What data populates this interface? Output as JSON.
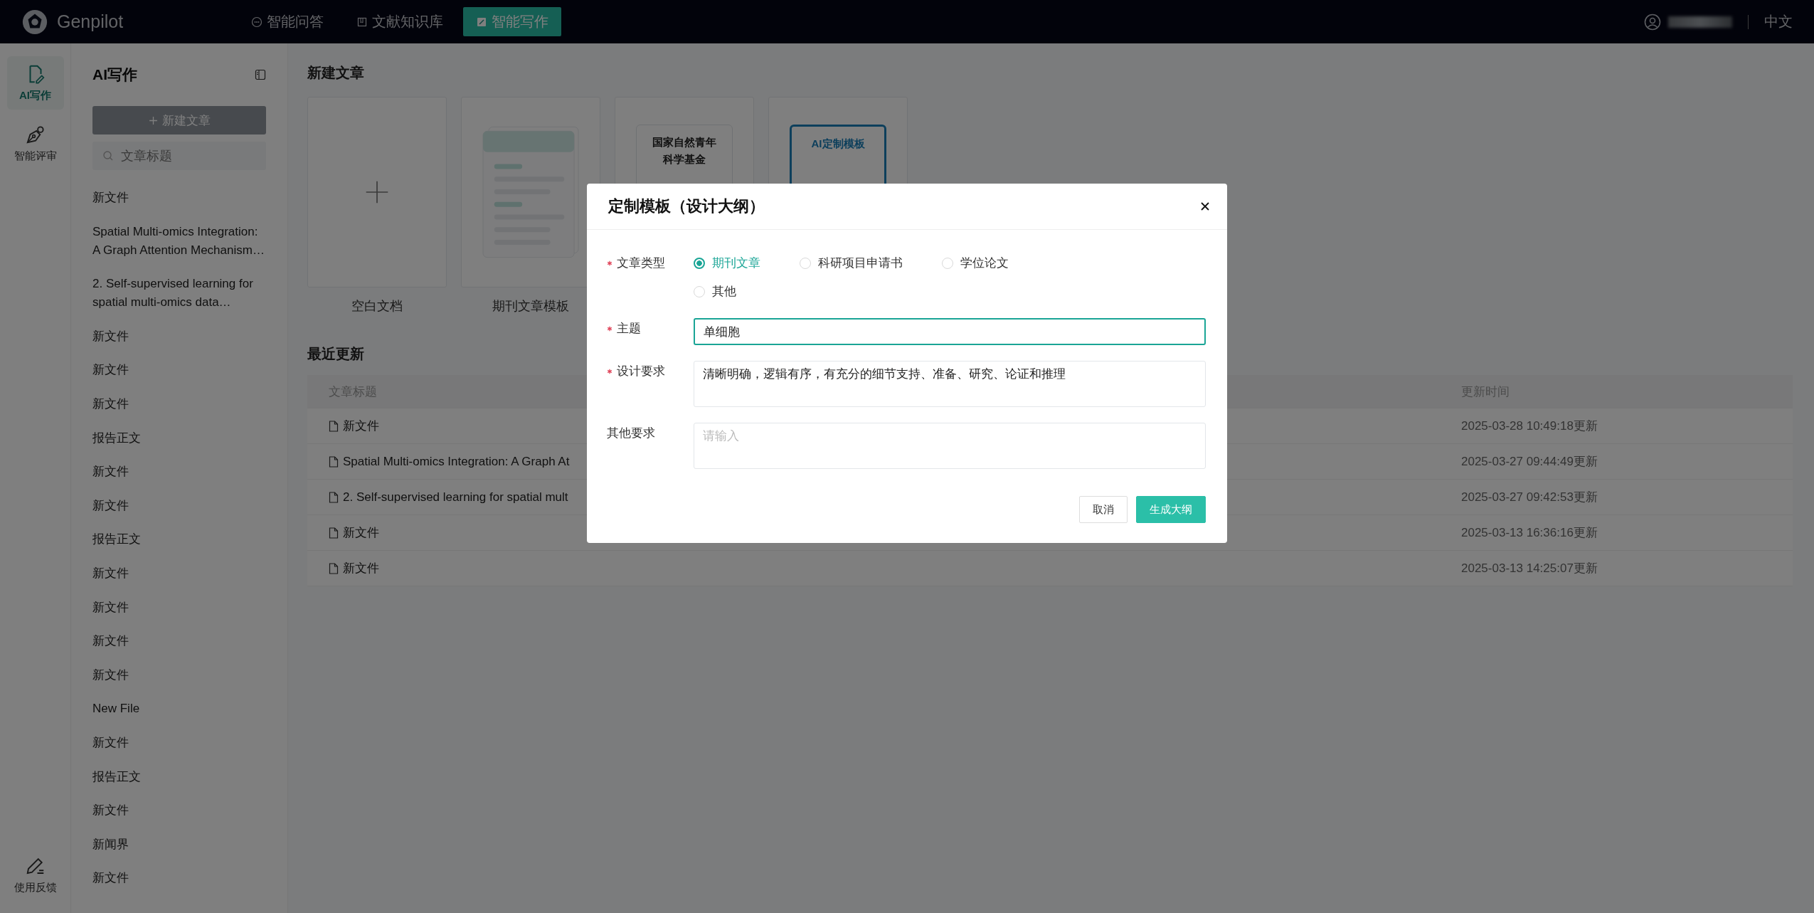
{
  "topbar": {
    "brand": "Genpilot",
    "nav": [
      {
        "label": "智能问答",
        "kind": "chat",
        "selected": false
      },
      {
        "label": "文献知识库",
        "kind": "book",
        "selected": false
      },
      {
        "label": "智能写作",
        "kind": "write",
        "selected": true
      }
    ],
    "language": "中文"
  },
  "rail": {
    "items": [
      {
        "label": "AI写作",
        "kind": "doc",
        "selected": true
      },
      {
        "label": "智能评审",
        "kind": "pen",
        "selected": false
      }
    ],
    "feedback": "使用反馈"
  },
  "sidebar": {
    "title": "AI写作",
    "new_button": "新建文章",
    "search": {
      "placeholder": "文章标题"
    },
    "items": [
      "新文件",
      "Spatial Multi-omics Integration: A Graph Attention Mechanism…",
      "2. Self-supervised learning for spatial multi-omics data…",
      "新文件",
      "新文件",
      "新文件",
      "报告正文",
      "新文件",
      "新文件",
      "报告正文",
      "新文件",
      "新文件",
      "新文件",
      "新文件",
      "New File",
      "新文件",
      "报告正文",
      "新文件",
      "新闻界",
      "新文件"
    ]
  },
  "new_section": {
    "title": "新建文章",
    "cards": [
      {
        "kind": "blank",
        "label": "空白文档"
      },
      {
        "kind": "journal",
        "label": "期刊文章模板"
      },
      {
        "kind": "fund",
        "heading": "国家自然青年科学基金"
      },
      {
        "kind": "ai",
        "heading": "AI定制模板"
      }
    ]
  },
  "recent": {
    "title": "最近更新",
    "columns": [
      "文章标题",
      "更新时间"
    ],
    "rows": [
      {
        "title": "新文件",
        "time": "2025-03-28 10:49:18更新"
      },
      {
        "title": "Spatial Multi-omics Integration: A Graph At",
        "time": "2025-03-27 09:44:49更新"
      },
      {
        "title": "2. Self-supervised learning for spatial mult",
        "time": "2025-03-27 09:42:53更新"
      },
      {
        "title": "新文件",
        "time": "2025-03-13 16:36:16更新"
      },
      {
        "title": "新文件",
        "time": "2025-03-13 14:25:07更新"
      }
    ]
  },
  "dialog": {
    "title": "定制模板（设计大纲）",
    "fields": [
      {
        "kind": "radio",
        "label": "文章类型",
        "required": true,
        "options": [
          {
            "label": "期刊文章",
            "selected": true
          },
          {
            "label": "科研项目申请书",
            "selected": false
          },
          {
            "label": "学位论文",
            "selected": false
          },
          {
            "label": "其他",
            "selected": false
          }
        ]
      },
      {
        "kind": "input",
        "label": "主题",
        "required": true,
        "value": "单细胞"
      },
      {
        "kind": "textarea",
        "label": "设计要求",
        "required": true,
        "value": "清晰明确，逻辑有序，有充分的细节支持、准备、研究、论证和推理"
      },
      {
        "kind": "textarea",
        "label": "其他要求",
        "required": false,
        "placeholder": "请输入"
      }
    ],
    "buttons": [
      {
        "label": "取消",
        "kind": "secondary"
      },
      {
        "label": "生成大纲",
        "kind": "primary"
      }
    ]
  }
}
